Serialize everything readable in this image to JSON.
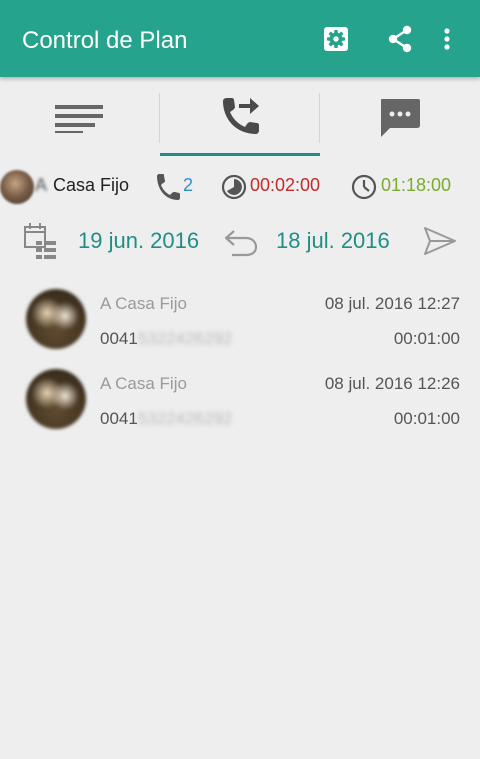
{
  "app": {
    "title": "Control de Plan",
    "accent": "#26a38d",
    "actions": [
      "settings-icon",
      "share-icon",
      "more-vert-icon"
    ]
  },
  "tabs": [
    {
      "name": "list-icon",
      "active": false
    },
    {
      "name": "call-transfer-icon",
      "active": true
    },
    {
      "name": "message-icon",
      "active": false
    }
  ],
  "summary": {
    "name_prefix": "A",
    "name": "Casa Fijo",
    "call_count": "2",
    "duration": "00:02:00",
    "plan_time": "01:18:00",
    "colors": {
      "count": "#2f8fc9",
      "duration": "#c42a2a",
      "plan": "#7aab2a"
    }
  },
  "date_range": {
    "start": "19 jun. 2016",
    "end": "18 jul. 2016"
  },
  "calls": [
    {
      "name": "A Casa Fijo",
      "number_visible": "0041",
      "number_hidden": "5322426292",
      "datetime": "08 jul. 2016 12:27",
      "duration": "00:01:00"
    },
    {
      "name": "A Casa Fijo",
      "number_visible": "0041",
      "number_hidden": "5322426292",
      "datetime": "08 jul. 2016 12:26",
      "duration": "00:01:00"
    }
  ]
}
